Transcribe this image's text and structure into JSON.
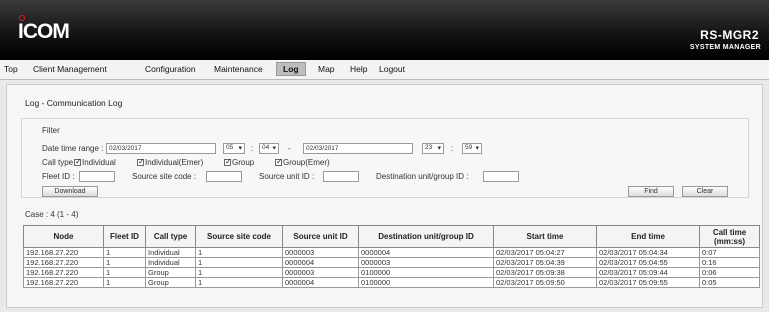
{
  "header": {
    "logo": "ICOM",
    "product": "RS-MGR2",
    "subproduct": "SYSTEM MANAGER"
  },
  "menu": [
    {
      "label": "Top"
    },
    {
      "label": "Client Management"
    },
    {
      "label": "Configuration"
    },
    {
      "label": "Maintenance"
    },
    {
      "label": "Log",
      "active": true
    },
    {
      "label": "Map"
    },
    {
      "label": "Help"
    },
    {
      "label": "Logout"
    }
  ],
  "page_title": "Log - Communication Log",
  "filter": {
    "title": "Filter",
    "date_time_range_label": "Date time range :",
    "start_date": "02/03/2017",
    "start_hour": "05",
    "start_minute": "04",
    "range_sep": "-",
    "end_date": "02/03/2017",
    "end_hour": "23",
    "end_minute": "59",
    "colon": ":",
    "call_type_label": "Call type",
    "call_types": [
      "Individual",
      "Individual(Emer)",
      "Group",
      "Group(Emer)"
    ],
    "fleet_id_label": "Fleet ID :",
    "source_site_code_label": "Source site code :",
    "source_unit_id_label": "Source unit ID :",
    "destination_label": "Destination unit/group ID :",
    "download_label": "Download",
    "find_label": "Find",
    "clear_label": "Clear"
  },
  "case_text": "Case : 4 (1 - 4)",
  "table": {
    "headers": [
      "Node",
      "Fleet ID",
      "Call type",
      "Source site code",
      "Source unit ID",
      "Destination unit/group ID",
      "Start time",
      "End time",
      "Call time (mm:ss)"
    ],
    "rows": [
      [
        "192.168.27.220",
        "1",
        "Individual",
        "1",
        "0000003",
        "0000004",
        "02/03/2017 05:04:27",
        "02/03/2017 05:04:34",
        "0:07"
      ],
      [
        "192.168.27.220",
        "1",
        "Individual",
        "1",
        "0000004",
        "0000003",
        "02/03/2017 05:04:39",
        "02/03/2017 05:04:55",
        "0:16"
      ],
      [
        "192.168.27.220",
        "1",
        "Group",
        "1",
        "0000003",
        "0100000",
        "02/03/2017 05:09:38",
        "02/03/2017 05:09:44",
        "0:06"
      ],
      [
        "192.168.27.220",
        "1",
        "Group",
        "1",
        "0000004",
        "0100000",
        "02/03/2017 05:09:50",
        "02/03/2017 05:09:55",
        "0:05"
      ]
    ]
  }
}
